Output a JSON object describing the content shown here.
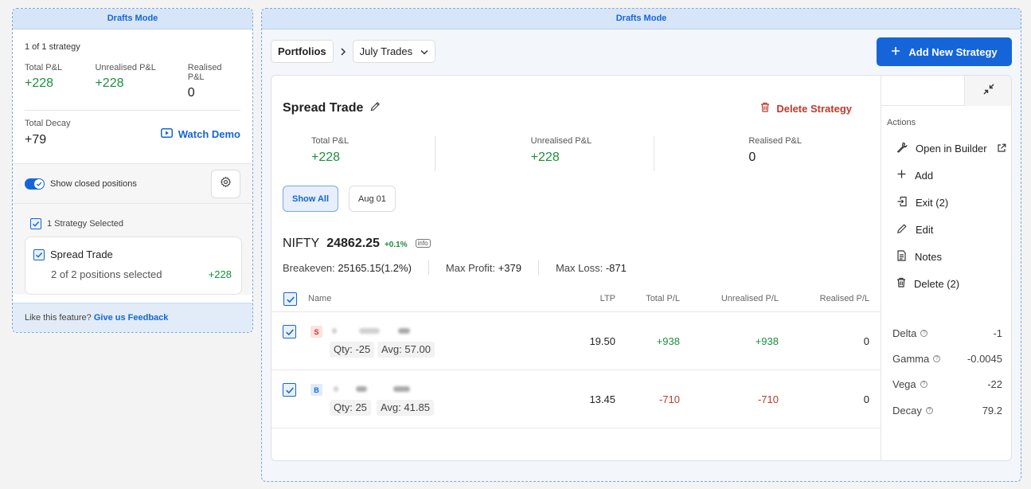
{
  "mode_label": "Drafts Mode",
  "left": {
    "strategy_count": "1 of 1 strategy",
    "pnl": [
      {
        "label": "Total P&L",
        "value": "+228"
      },
      {
        "label": "Unrealised P&L",
        "value": "+228"
      },
      {
        "label": "Realised P&L",
        "value": "0"
      }
    ],
    "decay_label": "Total Decay",
    "decay_value": "+79",
    "watch_demo": "Watch Demo",
    "toggle_label": "Show closed positions",
    "selected_label": "1 Strategy Selected",
    "strategy": {
      "name": "Spread Trade",
      "positions": "2 of 2 positions selected",
      "pnl": "+228"
    },
    "feedback_text": "Like this feature?",
    "feedback_link": "Give us Feedback"
  },
  "breadcrumb": {
    "root": "Portfolios",
    "current": "July Trades"
  },
  "add_strategy": "Add New Strategy",
  "strategy": {
    "title": "Spread Trade",
    "delete_label": "Delete Strategy",
    "pnl": [
      {
        "label": "Total P&L",
        "value": "+228"
      },
      {
        "label": "Unrealised P&L",
        "value": "+228"
      },
      {
        "label": "Realised P&L",
        "value": "0"
      }
    ],
    "filters": [
      "Show All",
      "Aug 01"
    ],
    "underlying": {
      "name": "NIFTY",
      "price": "24862.25",
      "change": "+0.1%",
      "info": "info"
    },
    "metrics": [
      {
        "label": "Breakeven:",
        "value": "25165.15(1.2%)"
      },
      {
        "label": "Max Profit:",
        "value": "+379"
      },
      {
        "label": "Max Loss:",
        "value": "-871"
      }
    ],
    "columns": [
      "Name",
      "LTP",
      "Total P/L",
      "Unrealised P/L",
      "Realised P/L"
    ],
    "positions": [
      {
        "side": "S",
        "qty": "Qty: -25",
        "avg": "Avg: 57.00",
        "ltp": "19.50",
        "total": "+938",
        "unrealised": "+938",
        "realised": "0"
      },
      {
        "side": "B",
        "qty": "Qty: 25",
        "avg": "Avg: 41.85",
        "ltp": "13.45",
        "total": "-710",
        "unrealised": "-710",
        "realised": "0"
      }
    ]
  },
  "actions": {
    "label": "Actions",
    "items": [
      "Open in Builder",
      "Add",
      "Exit (2)",
      "Edit",
      "Notes",
      "Delete (2)"
    ]
  },
  "greeks": [
    {
      "label": "Delta",
      "value": "-1"
    },
    {
      "label": "Gamma",
      "value": "-0.0045"
    },
    {
      "label": "Vega",
      "value": "-22"
    },
    {
      "label": "Decay",
      "value": "79.2"
    }
  ],
  "colors": {
    "accent": "#1565d8",
    "profit": "#1a8f3c",
    "loss": "#c0392b"
  }
}
